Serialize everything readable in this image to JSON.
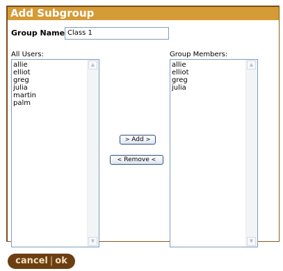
{
  "dialog": {
    "title": "Add Subgroup",
    "group_name_label": "Group Name:",
    "group_name_value": "Class 1",
    "all_users_label": "All Users:",
    "group_members_label": "Group Members:",
    "all_users": [
      "allie",
      "elliot",
      "greg",
      "julia",
      "martin",
      "palm"
    ],
    "group_members": [
      "allie",
      "elliot",
      "greg",
      "julia"
    ],
    "add_button": {
      "left_chevron": ">",
      "label": "Add",
      "right_chevron": ">"
    },
    "remove_button": {
      "left_chevron": "<",
      "label": "Remove",
      "right_chevron": "<"
    },
    "scroll_up_glyph": "▲",
    "scroll_down_glyph": "▼"
  },
  "footer": {
    "cancel_label": "cancel",
    "separator": "|",
    "ok_label": "ok"
  },
  "colors": {
    "title_bar": "#d59b36",
    "dialog_border": "#7a4d14",
    "footer_button": "#6b3f13"
  }
}
